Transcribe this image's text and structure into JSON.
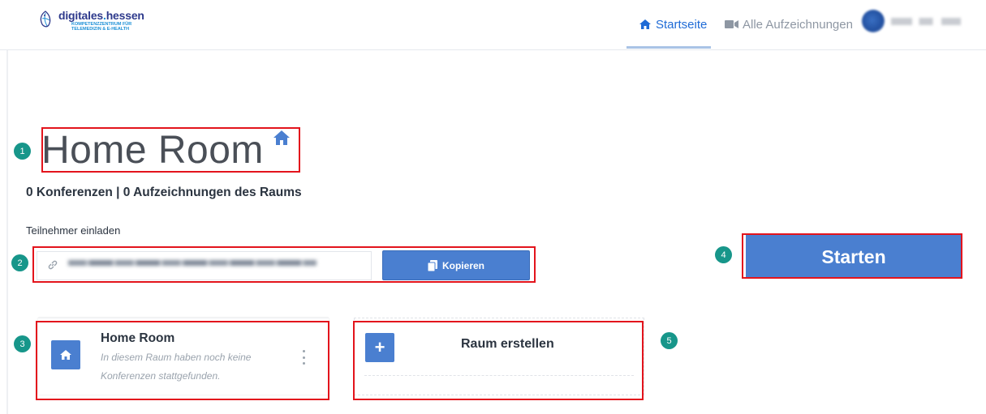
{
  "nav": {
    "logo_title_a": "digitales",
    "logo_title_b": "hessen",
    "logo_sub_1": "KOMPETENZZENTRUM FÜR",
    "logo_sub_2": "TELEMEDIZIN & E-HEALTH",
    "home_label": "Startseite",
    "recordings_label": "Alle Aufzeichnungen",
    "home_icon": "home-icon",
    "recordings_icon": "video-camera-icon"
  },
  "room": {
    "title": "Home Room",
    "stats": "0 Konferenzen | 0 Aufzeichnungen des Raums"
  },
  "invite": {
    "label": "Teilnehmer einladen",
    "copy_label": "Kopieren"
  },
  "start": {
    "label": "Starten"
  },
  "cards": {
    "home_title": "Home Room",
    "home_desc": "In diesem Raum haben noch keine Konferenzen stattgefunden.",
    "create_label": "Raum erstellen",
    "plus_symbol": "+"
  },
  "annotations": {
    "b1": "1",
    "b2": "2",
    "b3": "3",
    "b4": "4",
    "b5": "5"
  },
  "colors": {
    "primary": "#4a7fd0",
    "annotation_red": "#e3141c",
    "badge_teal": "#17968a",
    "nav_active": "#1f6bd6"
  }
}
